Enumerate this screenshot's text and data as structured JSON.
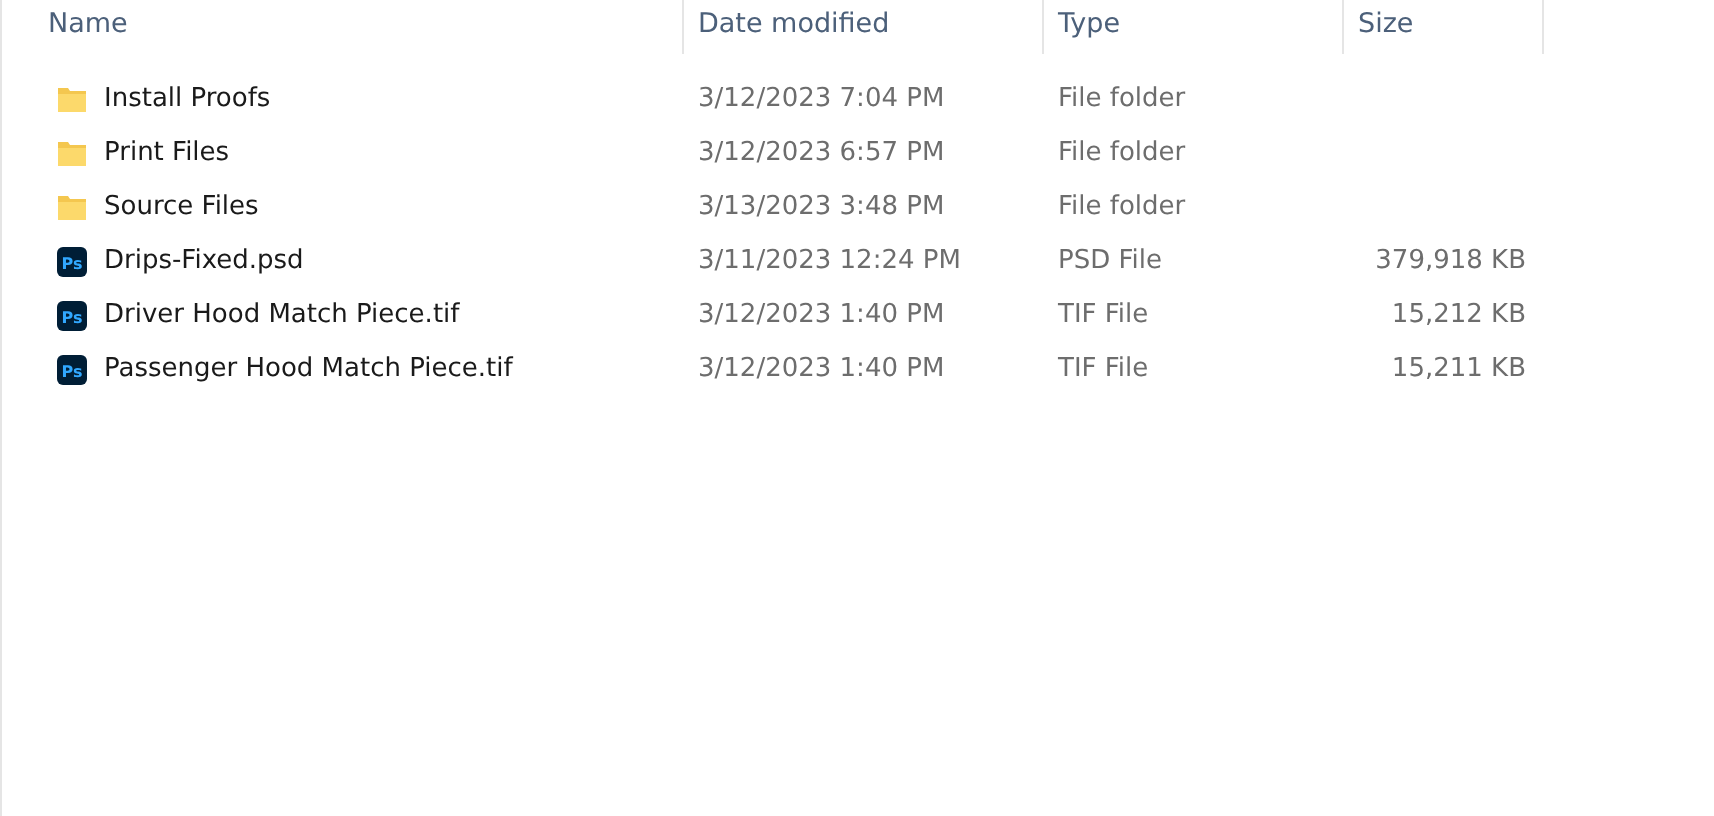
{
  "columns": [
    {
      "label": "Name"
    },
    {
      "label": "Date modified"
    },
    {
      "label": "Type"
    },
    {
      "label": "Size"
    }
  ],
  "rows": [
    {
      "kind": "folder",
      "name": "Install Proofs",
      "date": "3/12/2023 7:04 PM",
      "type": "File folder"
    },
    {
      "kind": "folder",
      "name": "Print Files",
      "date": "3/12/2023 6:57 PM",
      "type": "File folder"
    },
    {
      "kind": "folder",
      "name": "Source Files",
      "date": "3/13/2023 3:48 PM",
      "type": "File folder"
    },
    {
      "kind": "psd",
      "icon_text": "Ps",
      "name": "Drips-Fixed.psd",
      "date": "3/11/2023 12:24 PM",
      "type": "PSD File",
      "size": "379,918 KB"
    },
    {
      "kind": "psd",
      "icon_text": "Ps",
      "name": "Driver Hood Match Piece.tif",
      "date": "3/12/2023 1:40 PM",
      "type": "TIF File",
      "size": "15,212 KB"
    },
    {
      "kind": "psd",
      "icon_text": "Ps",
      "name": "Passenger Hood Match Piece.tif",
      "date": "3/12/2023 1:40 PM",
      "type": "TIF File",
      "size": "15,211 KB"
    }
  ]
}
